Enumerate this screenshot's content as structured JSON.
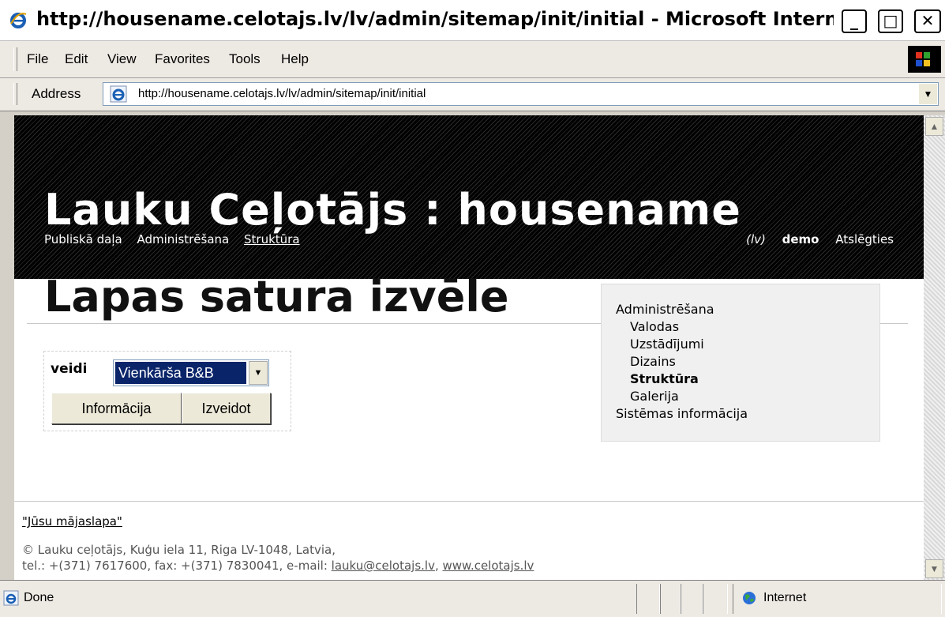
{
  "window": {
    "title": "http://housename.celotajs.lv/lv/admin/sitemap/init/initial - Microsoft Internet Explorer",
    "minimize_icon": "minimize-icon",
    "maximize_icon": "maximize-icon",
    "close_icon": "close-icon"
  },
  "menu": {
    "items": [
      "File",
      "Edit",
      "View",
      "Favorites",
      "Tools",
      "Help"
    ]
  },
  "address": {
    "label": "Address",
    "url": "http://housename.celotajs.lv/lv/admin/sitemap/init/initial"
  },
  "page": {
    "site_title": "Lauku Ceļotājs : housename",
    "nav": [
      "Publiskā daļa",
      "Administrēšana",
      "Struktūra"
    ],
    "lang": "(lv)",
    "user": "demo",
    "logout": "Atslēgties",
    "heading": "Lapas satura izvēle",
    "form": {
      "label": "veidi",
      "select_value": "Vienkārša B&B",
      "info_button": "Informācija",
      "create_button": "Izveidot"
    },
    "sidebar": {
      "items": [
        {
          "label": "Administrēšana",
          "level": 0,
          "active": false
        },
        {
          "label": "Valodas",
          "level": 1,
          "active": false
        },
        {
          "label": "Uzstādījumi",
          "level": 1,
          "active": false
        },
        {
          "label": "Dizains",
          "level": 1,
          "active": false
        },
        {
          "label": "Struktūra",
          "level": 1,
          "active": true
        },
        {
          "label": "Galerija",
          "level": 1,
          "active": false
        },
        {
          "label": "Sistēmas informācija",
          "level": 0,
          "active": false
        }
      ]
    },
    "footer": {
      "link": "\"Jūsu mājaslapa\"",
      "address_line": "© Lauku ceļotājs, Kuģu iela 11, Riga LV-1048, Latvia,",
      "contact_prefix": "tel.: +(371) 7617600, fax: +(371) 7830041, e-mail: ",
      "email": "lauku@celotajs.lv",
      "separator": ", ",
      "website": "www.celotajs.lv"
    }
  },
  "status": {
    "text": "Done",
    "zone": "Internet"
  }
}
